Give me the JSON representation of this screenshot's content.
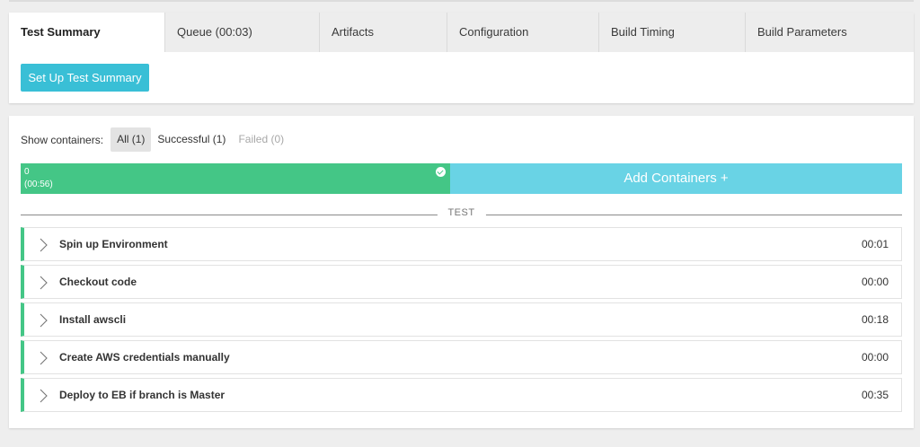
{
  "tabs": [
    {
      "label": "Test Summary",
      "active": true
    },
    {
      "label": "Queue (00:03)",
      "active": false
    },
    {
      "label": "Artifacts",
      "active": false
    },
    {
      "label": "Configuration",
      "active": false
    },
    {
      "label": "Build Timing",
      "active": false
    },
    {
      "label": "Build Parameters",
      "active": false
    }
  ],
  "setup_button": "Set Up Test Summary",
  "filters": {
    "label": "Show containers:",
    "all": "All (1)",
    "successful": "Successful (1)",
    "failed": "Failed (0)"
  },
  "container": {
    "index": "0",
    "duration": "(00:56)",
    "status_icon": "check-circle-icon",
    "status_color": "#44c686"
  },
  "add_containers": "Add Containers +",
  "section_label": "TEST",
  "steps": [
    {
      "name": "Spin up Environment",
      "time": "00:01"
    },
    {
      "name": "Checkout code",
      "time": "00:00"
    },
    {
      "name": "Install awscli",
      "time": "00:18"
    },
    {
      "name": "Create AWS credentials manually",
      "time": "00:00"
    },
    {
      "name": "Deploy to EB if branch is Master",
      "time": "00:35"
    }
  ],
  "colors": {
    "accent": "#39bfd6",
    "success": "#44c686",
    "add_containers": "#69d3e5"
  }
}
